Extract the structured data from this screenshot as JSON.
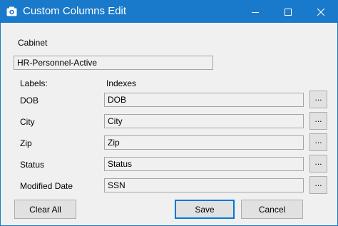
{
  "window": {
    "title": "Custom Columns Edit",
    "controls": {
      "minimize": "minimize-icon",
      "maximize": "maximize-icon",
      "close": "close-icon"
    }
  },
  "cabinet": {
    "label": "Cabinet",
    "value": "HR-Personnel-Active"
  },
  "headers": {
    "labels": "Labels:",
    "indexes": "Indexes"
  },
  "rows": [
    {
      "label": "DOB",
      "index": "DOB",
      "browse": "..."
    },
    {
      "label": "City",
      "index": "City",
      "browse": "..."
    },
    {
      "label": "Zip",
      "index": "Zip",
      "browse": "..."
    },
    {
      "label": "Status",
      "index": "Status",
      "browse": "..."
    },
    {
      "label": "Modified Date",
      "index": "SSN",
      "browse": "..."
    }
  ],
  "buttons": {
    "clear_all": "Clear All",
    "save": "Save",
    "cancel": "Cancel"
  },
  "colors": {
    "titlebar": "#1979ca",
    "dialog_bg": "#f0f0f0",
    "default_button_border": "#0078d7"
  }
}
